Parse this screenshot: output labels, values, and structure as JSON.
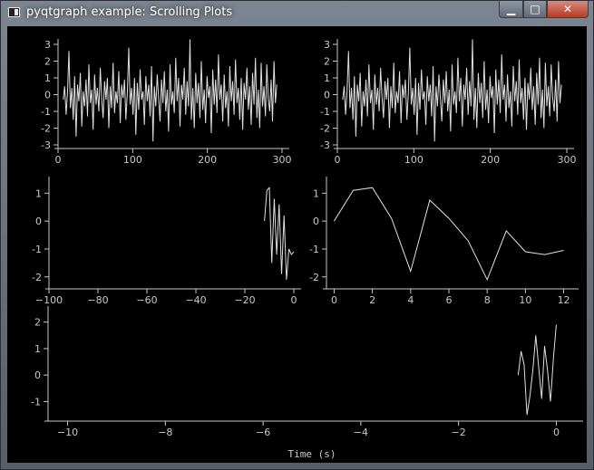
{
  "window": {
    "title": "pyqtgraph example: Scrolling Plots",
    "buttons": {
      "minimize": "▁",
      "maximize": "□",
      "close": "✕"
    }
  },
  "colors": {
    "background": "#000000",
    "axis": "#c8c8c8",
    "curve": "#e0e0e0"
  },
  "chart_data": [
    {
      "type": "line",
      "xlim": [
        0,
        300
      ],
      "ylim": [
        -3,
        3
      ],
      "x_ticks": [
        0,
        100,
        200,
        300
      ],
      "y_ticks": [
        3,
        2,
        1,
        0,
        -1,
        -2,
        -3
      ],
      "x_ticks_label": [
        "0",
        "100",
        "200",
        "300"
      ],
      "y_ticks_label": [
        "3",
        "2",
        "1",
        "0",
        "-1",
        "-2",
        "-3"
      ],
      "series": [
        {
          "values": [
            -0.3,
            0.5,
            -1.2,
            0.2,
            2.6,
            -0.8,
            0.4,
            -1.5,
            1.1,
            -2.5,
            0.6,
            -0.4,
            1.3,
            -1.9,
            0.2,
            -0.7,
            0.9,
            -1.3,
            1.8,
            -0.5,
            0.3,
            -2.1,
            1.2,
            -0.6,
            0.4,
            -1.0,
            1.6,
            -0.2,
            -1.4,
            0.8,
            -0.3,
            1.0,
            -2.0,
            0.5,
            -0.8,
            1.9,
            -1.1,
            0.2,
            -0.5,
            1.4,
            -1.7,
            0.6,
            -0.2,
            0.9,
            -1.5,
            0.1,
            2.8,
            -0.6,
            0.4,
            -1.2,
            1.0,
            -2.4,
            0.7,
            -0.9,
            1.5,
            -0.3,
            0.2,
            -1.8,
            1.1,
            -0.4,
            0.6,
            -1.3,
            1.7,
            -2.8,
            0.5,
            -0.7,
            1.2,
            -0.2,
            -1.6,
            0.9,
            -0.5,
            1.4,
            -1.0,
            0.3,
            -2.2,
            1.8,
            -0.6,
            0.2,
            -1.1,
            2.2,
            -0.4,
            1.0,
            -1.9,
            0.6,
            -0.3,
            1.6,
            -1.2,
            0.8,
            -0.7,
            3.3,
            -1.5,
            0.4,
            -2.0,
            1.3,
            -0.5,
            0.7,
            -1.4,
            2.0,
            -0.9,
            0.3,
            -1.7,
            1.1,
            -0.2,
            0.5,
            -2.3,
            1.5,
            -0.6,
            0.9,
            -1.1,
            2.4,
            -0.3,
            0.6,
            -1.6,
            1.2,
            -0.8,
            0.2,
            -1.9,
            1.7,
            -0.4,
            0.8,
            -1.2,
            2.1,
            -0.5,
            0.4,
            -1.5,
            1.0,
            -2.1,
            0.7,
            -0.3,
            1.6,
            -0.9,
            0.5,
            -1.8,
            1.3,
            -0.6,
            2.2,
            -1.4,
            0.3,
            -2.0,
            1.9,
            -0.7,
            0.5,
            -1.3,
            1.8,
            -0.2,
            -1.0,
            0.9,
            -1.6,
            2.0,
            -0.5,
            0.6
          ]
        }
      ]
    },
    {
      "type": "line",
      "xlim": [
        0,
        300
      ],
      "ylim": [
        -3,
        3
      ],
      "x_ticks": [
        0,
        100,
        200,
        300
      ],
      "y_ticks": [
        3,
        2,
        1,
        0,
        -1,
        -2,
        -3
      ],
      "x_ticks_label": [
        "0",
        "100",
        "200",
        "300"
      ],
      "y_ticks_label": [
        "3",
        "2",
        "1",
        "0",
        "-1",
        "-2",
        "-3"
      ],
      "series": [
        {
          "values": [
            -0.3,
            0.5,
            -1.2,
            0.2,
            2.6,
            -0.8,
            0.4,
            -1.5,
            1.1,
            -2.5,
            0.6,
            -0.4,
            1.3,
            -1.9,
            0.2,
            -0.7,
            0.9,
            -1.3,
            1.8,
            -0.5,
            0.3,
            -2.1,
            1.2,
            -0.6,
            0.4,
            -1.0,
            1.6,
            -0.2,
            -1.4,
            0.8,
            -0.3,
            1.0,
            -2.0,
            0.5,
            -0.8,
            1.9,
            -1.1,
            0.2,
            -0.5,
            1.4,
            -1.7,
            0.6,
            -0.2,
            0.9,
            -1.5,
            0.1,
            2.8,
            -0.6,
            0.4,
            -1.2,
            1.0,
            -2.4,
            0.7,
            -0.9,
            1.5,
            -0.3,
            0.2,
            -1.8,
            1.1,
            -0.4,
            0.6,
            -1.3,
            1.7,
            -2.8,
            0.5,
            -0.7,
            1.2,
            -0.2,
            -1.6,
            0.9,
            -0.5,
            1.4,
            -1.0,
            0.3,
            -2.2,
            1.8,
            -0.6,
            0.2,
            -1.1,
            2.2,
            -0.4,
            1.0,
            -1.9,
            0.6,
            -0.3,
            1.6,
            -1.2,
            0.8,
            -0.7,
            3.3,
            -1.5,
            0.4,
            -2.0,
            1.3,
            -0.5,
            0.7,
            -1.4,
            2.0,
            -0.9,
            0.3,
            -1.7,
            1.1,
            -0.2,
            0.5,
            -2.3,
            1.5,
            -0.6,
            0.9,
            -1.1,
            2.4,
            -0.3,
            0.6,
            -1.6,
            1.2,
            -0.8,
            0.2,
            -1.9,
            1.7,
            -0.4,
            0.8,
            -1.2,
            2.1,
            -0.5,
            0.4,
            -1.5,
            1.0,
            -2.1,
            0.7,
            -0.3,
            1.6,
            -0.9,
            0.5,
            -1.8,
            1.3,
            -0.6,
            2.2,
            -1.4,
            0.3,
            -2.0,
            1.9,
            -0.7,
            0.5,
            -1.3,
            1.8,
            -0.2,
            -1.0,
            0.9,
            -1.6,
            2.0,
            -0.5,
            0.6
          ]
        }
      ]
    },
    {
      "type": "line",
      "xlim": [
        -100,
        0
      ],
      "ylim": [
        -2.3,
        1.4
      ],
      "x_ticks": [
        -100,
        -80,
        -60,
        -40,
        -20,
        0
      ],
      "y_ticks": [
        1,
        0,
        -1,
        -2
      ],
      "x_ticks_label": [
        "−100",
        "−80",
        "−60",
        "−40",
        "−20",
        "0"
      ],
      "y_ticks_label": [
        "1",
        "0",
        "-1",
        "-2"
      ],
      "series": [
        {
          "x": [
            -12,
            -11,
            -10,
            -9,
            -8,
            -7,
            -6,
            -5,
            -4,
            -3,
            -2,
            -1,
            0
          ],
          "values": [
            0.0,
            1.1,
            1.2,
            -1.5,
            0.8,
            -1.2,
            0.6,
            -1.9,
            0.2,
            -2.1,
            -1.0,
            -1.2,
            -1.1
          ]
        }
      ]
    },
    {
      "type": "line",
      "xlim": [
        -0.4,
        12.4
      ],
      "ylim": [
        -2.3,
        1.4
      ],
      "x_ticks": [
        0,
        2,
        4,
        6,
        8,
        10,
        12
      ],
      "y_ticks": [
        1,
        0,
        -1,
        -2
      ],
      "x_ticks_label": [
        "0",
        "2",
        "4",
        "6",
        "8",
        "10",
        "12"
      ],
      "y_ticks_label": [
        "1",
        "0",
        "-1",
        "-2"
      ],
      "series": [
        {
          "x": [
            0,
            1,
            2,
            3,
            4,
            5,
            6,
            7,
            8,
            9,
            10,
            11,
            12
          ],
          "values": [
            0.0,
            1.1,
            1.2,
            0.1,
            -1.8,
            0.75,
            0.1,
            -0.7,
            -2.1,
            -0.35,
            -1.1,
            -1.2,
            -1.05
          ]
        }
      ]
    },
    {
      "type": "line",
      "xlim": [
        -10.4,
        0.4
      ],
      "ylim": [
        -1.6,
        2.4
      ],
      "x_ticks": [
        -10,
        -8,
        -6,
        -4,
        -2,
        0
      ],
      "y_ticks": [
        2,
        1,
        0,
        -1
      ],
      "x_ticks_label": [
        "−10",
        "−8",
        "−6",
        "−4",
        "−2",
        "0"
      ],
      "y_ticks_label": [
        "2",
        "1",
        "0",
        "-1"
      ],
      "xlabel": "Time (s)",
      "series": [
        {
          "x": [
            -0.78,
            -0.72,
            -0.66,
            -0.6,
            -0.54,
            -0.48,
            -0.42,
            -0.36,
            -0.3,
            -0.24,
            -0.18,
            -0.12,
            -0.06,
            0.0
          ],
          "values": [
            0.0,
            0.9,
            0.4,
            -1.5,
            -0.8,
            0.2,
            1.5,
            0.3,
            -0.9,
            1.1,
            0.2,
            -1.0,
            0.6,
            1.9
          ]
        }
      ]
    }
  ]
}
